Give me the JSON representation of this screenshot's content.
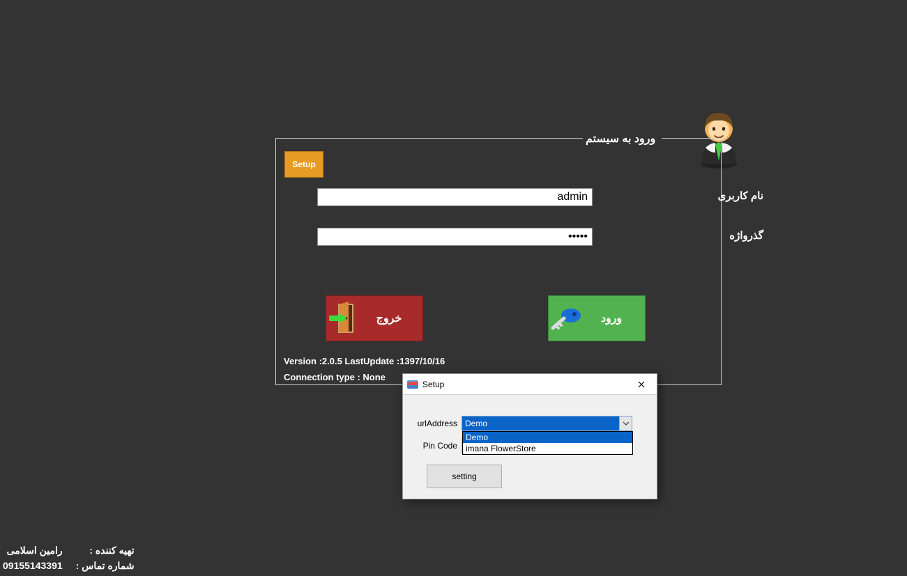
{
  "login": {
    "title": "ورود به سیستم",
    "setup_btn": "Setup",
    "username_label": "نام کاربری",
    "username_value": "admin",
    "password_label": "گذرواژه",
    "password_value": "•••••",
    "exit_btn": "خروج",
    "enter_btn": "ورود",
    "version_line": "Version :2.0.5  LastUpdate :1397/10/16",
    "connection_line": "Connection type : None"
  },
  "footer": {
    "producer_label": "تهیه کننده :",
    "producer_value": "رامین اسلامی",
    "phone_label": "شماره تماس :",
    "phone_value": "09155143391"
  },
  "dialog": {
    "title": "Setup",
    "url_label": "urlAddress",
    "url_selected": "Demo",
    "url_options": [
      "Demo",
      "imana FlowerStore"
    ],
    "pin_label": "Pin Code",
    "pin_value": "",
    "setting_btn": "setting"
  }
}
